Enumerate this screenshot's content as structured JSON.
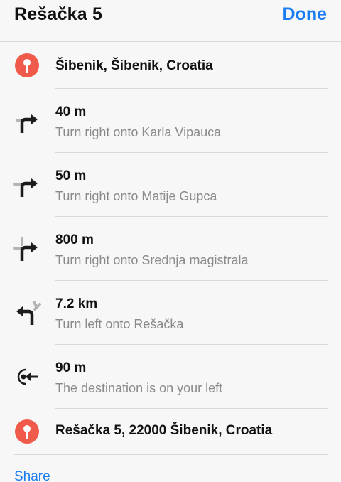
{
  "header": {
    "title": "Rešačka 5",
    "done_label": "Done"
  },
  "route": {
    "start": {
      "label": "Šibenik, Šibenik, Croatia",
      "icon": "location-pin-icon",
      "color": "#f05a4a"
    },
    "steps": [
      {
        "distance": "40 m",
        "instruction": "Turn right onto Karla Vipauca",
        "icon": "turn-right-icon"
      },
      {
        "distance": "50 m",
        "instruction": "Turn right onto Matije Gupca",
        "icon": "turn-right-icon"
      },
      {
        "distance": "800 m",
        "instruction": "Turn right onto Srednja magistrala",
        "icon": "turn-right-icon"
      },
      {
        "distance": "7.2 km",
        "instruction": "Turn left onto Rešačka",
        "icon": "turn-left-icon"
      },
      {
        "distance": "90 m",
        "instruction": "The destination is on your left",
        "icon": "arrive-left-icon"
      }
    ],
    "end": {
      "label": "Rešačka 5, 22000 Šibenik, Croatia",
      "icon": "location-pin-icon",
      "color": "#f05a4a"
    }
  },
  "footer": {
    "share_label": "Share"
  },
  "colors": {
    "accent": "#1a7cf3",
    "pin": "#f05a4a",
    "secondary_text": "#8a8a8a"
  }
}
